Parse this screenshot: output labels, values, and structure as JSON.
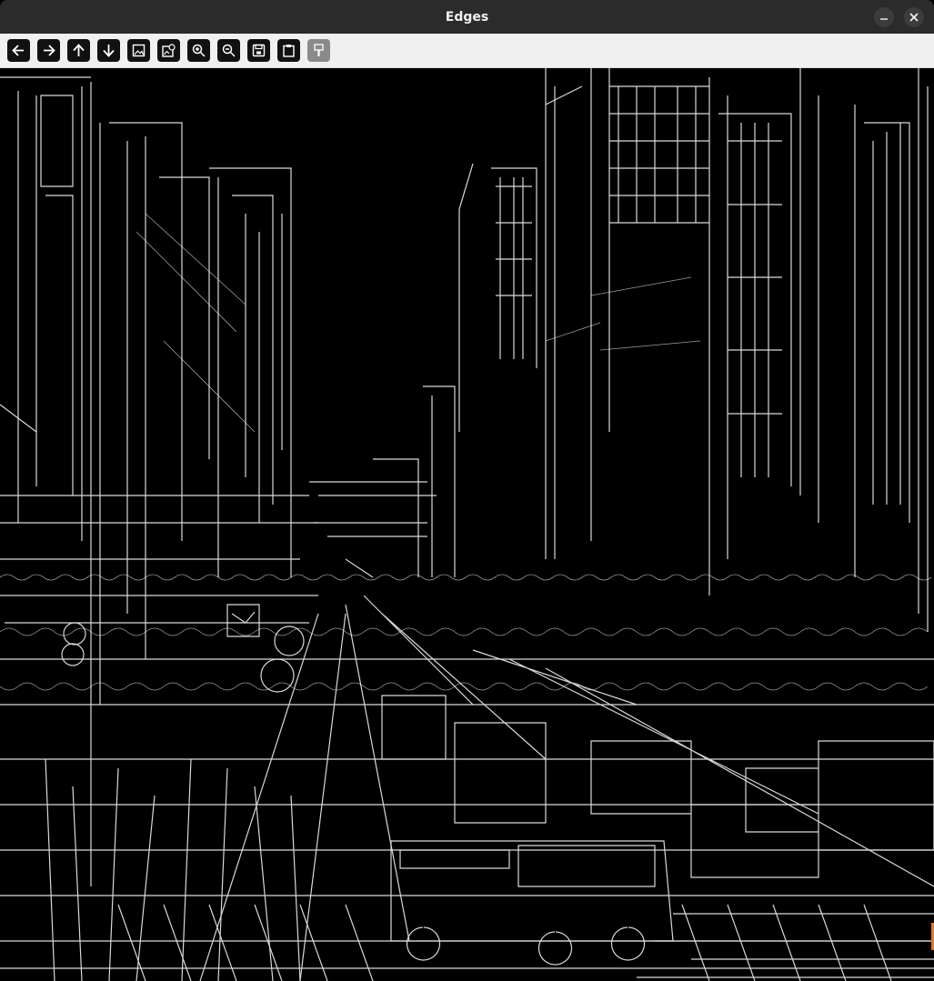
{
  "window": {
    "title": "Edges",
    "buttons": [
      "minimize",
      "close"
    ]
  },
  "toolbar": {
    "items": [
      {
        "name": "pan-left",
        "icon": "arrow-left-icon"
      },
      {
        "name": "pan-right",
        "icon": "arrow-right-icon"
      },
      {
        "name": "pan-up",
        "icon": "arrow-up-icon"
      },
      {
        "name": "pan-down",
        "icon": "arrow-down-icon"
      },
      {
        "name": "zoom-in-image",
        "icon": "image-icon"
      },
      {
        "name": "zoom-out-image",
        "icon": "image-zoom-icon"
      },
      {
        "name": "zoom-in",
        "icon": "zoom-in-icon"
      },
      {
        "name": "zoom-out",
        "icon": "zoom-out-icon"
      },
      {
        "name": "save-image",
        "icon": "save-icon"
      },
      {
        "name": "copy-to-clipboard",
        "icon": "clipboard-icon"
      },
      {
        "name": "properties",
        "icon": "brush-icon",
        "disabled": true
      }
    ]
  },
  "image": {
    "description_icon": "edge-detection-image",
    "background_color": "#000000",
    "edge_color": "#ffffff"
  }
}
